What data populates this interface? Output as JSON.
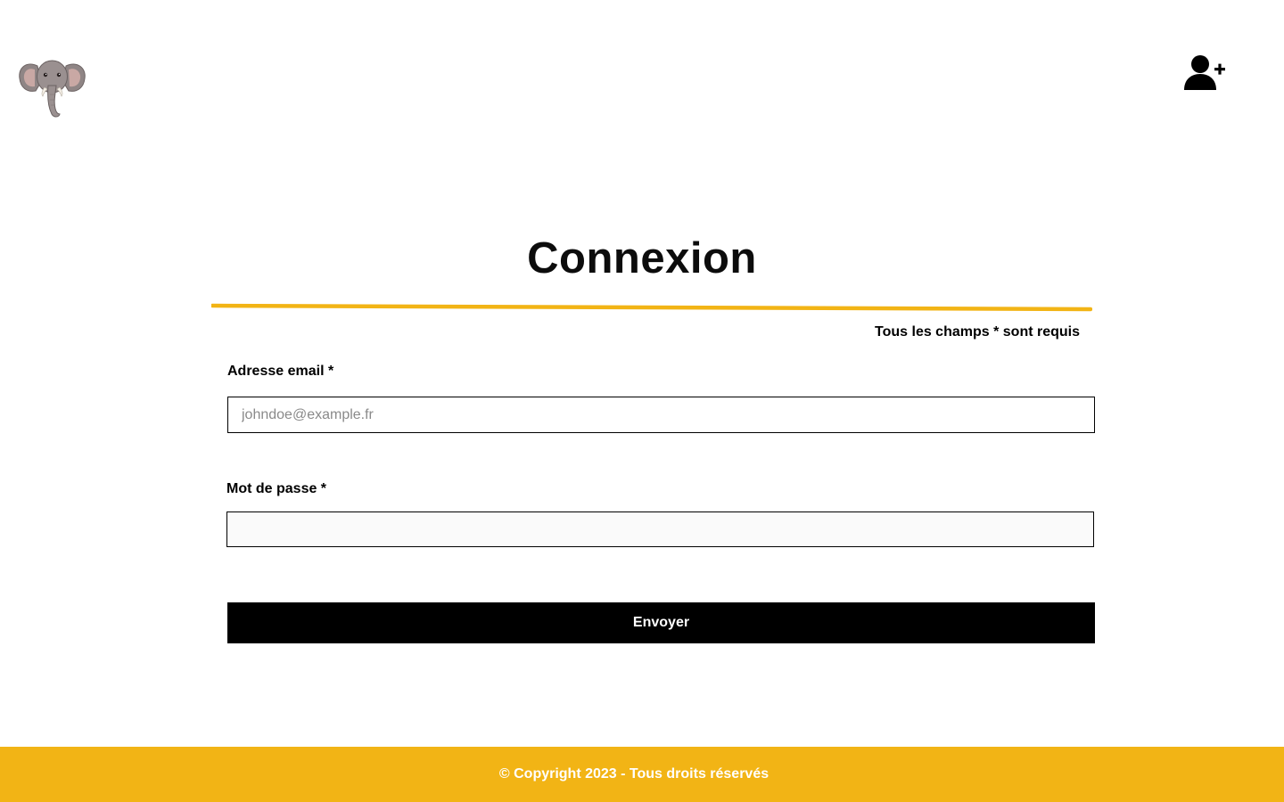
{
  "header": {
    "logo_icon": "elephant-logo-icon",
    "register_icon": "user-plus-icon"
  },
  "form": {
    "title": "Connexion",
    "required_note": "Tous les champs * sont requis",
    "email_label": "Adresse email *",
    "email_placeholder": "johndoe@example.fr",
    "email_value": "",
    "password_label": "Mot de passe *",
    "password_value": "",
    "submit_label": "Envoyer"
  },
  "footer": {
    "copyright": "© Copyright 2023 - Tous droits réservés"
  },
  "colors": {
    "accent": "#f2b415",
    "button_bg": "#000000",
    "text": "#000000"
  }
}
